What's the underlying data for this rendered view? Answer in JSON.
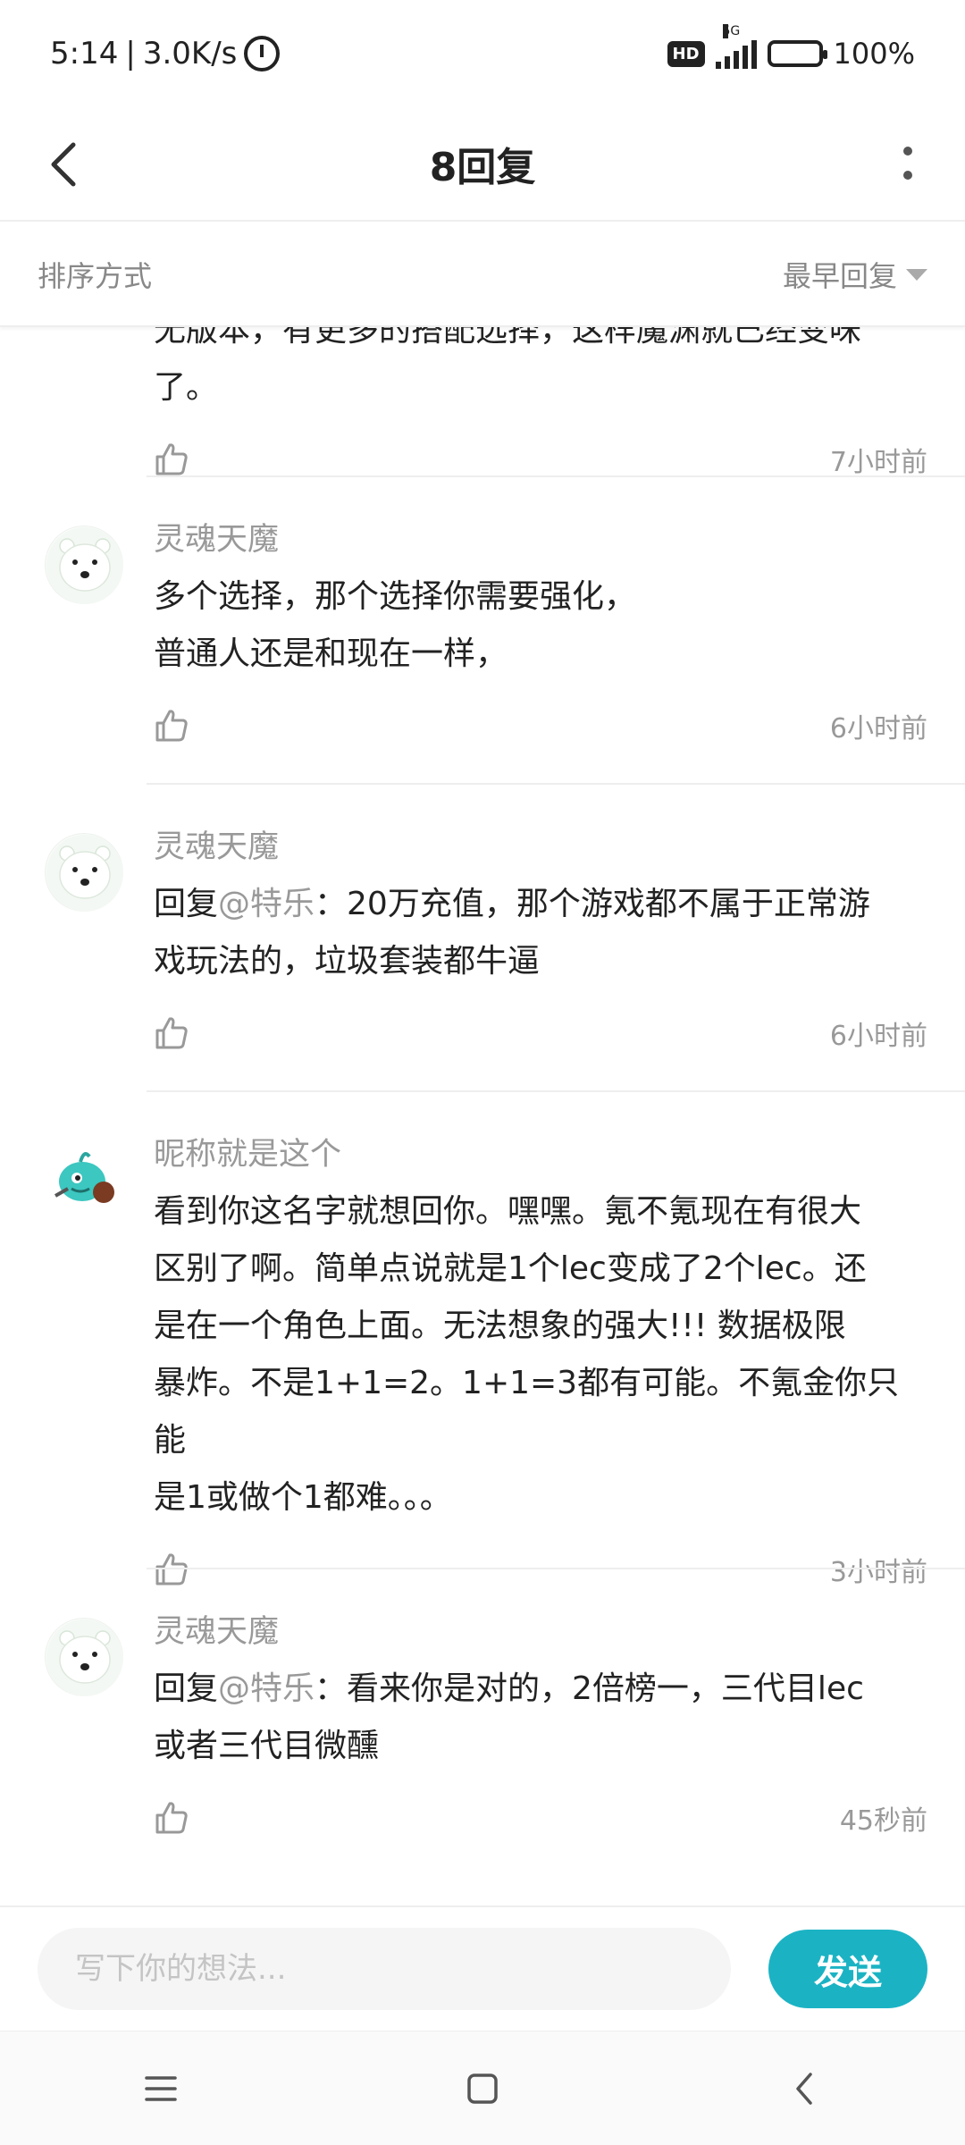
{
  "status_bar": {
    "time": "5:14",
    "network_speed": "3.0K/s",
    "separator": "|",
    "hd": "HD",
    "network_type": "5G",
    "battery": "100%"
  },
  "header": {
    "title": "8回复",
    "back_icon": "back-arrow-icon",
    "more_icon": "more-vertical-icon"
  },
  "sort": {
    "label": "排序方式",
    "value": "最早回复"
  },
  "replies": [
    {
      "name": "",
      "text_lines": [
        "无版本，有更多的搭配选择，这样魔渊就已经变味",
        "了。"
      ],
      "time": "7小时前"
    },
    {
      "name": "灵魂天魔",
      "text_lines": [
        "多个选择，那个选择你需要强化，",
        "普通人还是和现在一样，"
      ],
      "time": "6小时前"
    },
    {
      "name": "灵魂天魔",
      "prefix": "回复",
      "mention": "@特乐",
      "text_lines": [
        "：20万充值，那个游戏都不属于正常游",
        "戏玩法的，垃圾套装都牛逼"
      ],
      "time": "6小时前"
    },
    {
      "name": "昵称就是这个",
      "text_lines": [
        "看到你这名字就想回你。嘿嘿。氪不氪现在有很大",
        "区别了啊。简单点说就是1个lec变成了2个lec。还",
        "是在一个角色上面。无法想象的强大!!! 数据极限",
        "暴炸。不是1+1=2。1+1=3都有可能。不氪金你只能",
        "是1或做个1都难。。。"
      ],
      "time": "3小时前"
    },
    {
      "name": "灵魂天魔",
      "prefix": "回复",
      "mention": "@特乐",
      "text_lines": [
        "：看来你是对的，2倍榜一，三代目lec",
        "或者三代目微醺"
      ],
      "time": "45秒前"
    }
  ],
  "input": {
    "placeholder": "写下你的想法...",
    "send_label": "发送"
  },
  "colors": {
    "accent": "#1bb3c4",
    "muted_text": "#999999",
    "divider": "#eeeeee"
  }
}
